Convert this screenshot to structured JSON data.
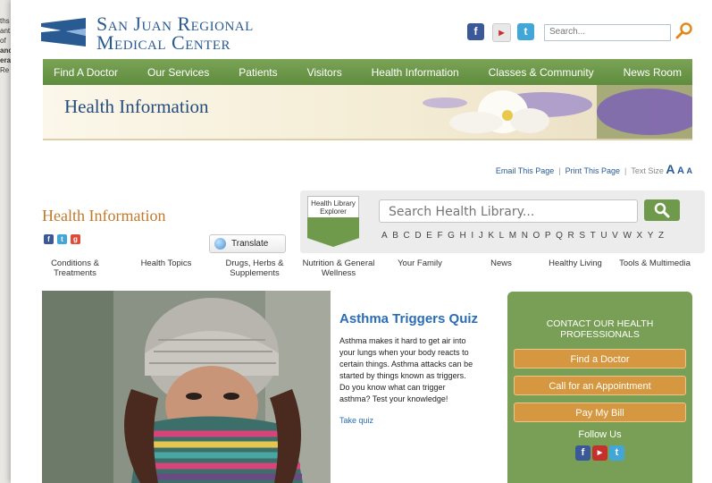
{
  "background_window": {
    "lines": [
      "ths",
      "ant:",
      "",
      "of",
      "",
      "anc",
      "era",
      "",
      "",
      "Re"
    ]
  },
  "header": {
    "brand_line1": "San Juan Regional",
    "brand_line2": "Medical Center",
    "search_placeholder": "Search..."
  },
  "nav": [
    "Find A Doctor",
    "Our Services",
    "Patients",
    "Visitors",
    "Health Information",
    "Classes & Community",
    "News Room"
  ],
  "banner": {
    "title": "Health Information"
  },
  "utility": {
    "email": "Email This Page",
    "print": "Print This Page",
    "text_size": "Text Size",
    "sizes": [
      "A",
      "A",
      "A"
    ]
  },
  "section": {
    "title": "Health Information",
    "translate": "Translate"
  },
  "library": {
    "explorer_label": "Health Library Explorer",
    "search_placeholder": "Search Health Library...",
    "alphabet": "ABCDEFGHIJKLMNOPQRSTUVWXYZ"
  },
  "categories": [
    "Conditions & Treatments",
    "Health Topics",
    "Drugs, Herbs & Supplements",
    "Nutrition & General Wellness",
    "Your Family",
    "News",
    "Healthy Living",
    "Tools & Multimedia"
  ],
  "feature": {
    "title": "Asthma Triggers Quiz",
    "body": "Asthma makes it hard to get air into your lungs when your body reacts to certain things. Asthma attacks can be started by things known as triggers. Do you know what can trigger asthma? Test your knowledge!",
    "link": "Take quiz"
  },
  "contact": {
    "heading": "CONTACT OUR HEALTH PROFESSIONALS",
    "buttons": [
      "Find a Doctor",
      "Call for an Appointment",
      "Pay My Bill"
    ],
    "follow": "Follow Us"
  },
  "colors": {
    "nav_green": "#6f9a4b",
    "brand_blue": "#2a5a92",
    "orange": "#d5973f",
    "link_blue": "#2a6db6"
  }
}
